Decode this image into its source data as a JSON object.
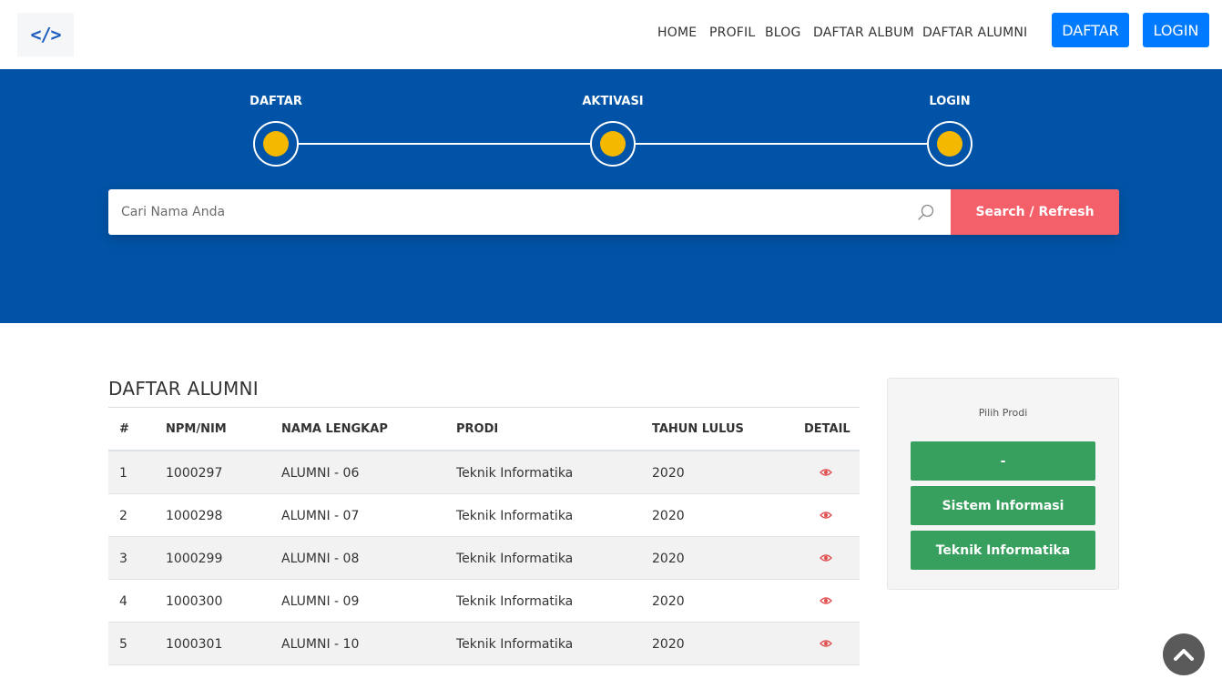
{
  "header": {
    "logo_text": "</>",
    "nav": [
      "HOME",
      "PROFIL",
      "BLOG",
      "DAFTAR ALBUM",
      "DAFTAR ALUMNI"
    ],
    "daftar_button": "DAFTAR",
    "login_button": "LOGIN"
  },
  "hero": {
    "steps": [
      "DAFTAR",
      "AKTIVASI",
      "LOGIN"
    ],
    "search": {
      "placeholder": "Cari Nama Anda",
      "value": "",
      "button": "Search / Refresh"
    }
  },
  "main": {
    "title": "DAFTAR ALUMNI",
    "columns": [
      "#",
      "NPM/NIM",
      "NAMA LENGKAP",
      "PRODI",
      "TAHUN LULUS",
      "DETAIL"
    ],
    "rows": [
      [
        "1",
        "1000297",
        "ALUMNI - 06",
        "Teknik Informatika",
        "2020"
      ],
      [
        "2",
        "1000298",
        "ALUMNI - 07",
        "Teknik Informatika",
        "2020"
      ],
      [
        "3",
        "1000299",
        "ALUMNI - 08",
        "Teknik Informatika",
        "2020"
      ],
      [
        "4",
        "1000300",
        "ALUMNI - 09",
        "Teknik Informatika",
        "2020"
      ],
      [
        "5",
        "1000301",
        "ALUMNI - 10",
        "Teknik Informatika",
        "2020"
      ]
    ],
    "detail_icon": "eye-icon"
  },
  "sidebar": {
    "title": "Pilih Prodi",
    "buttons": [
      "-",
      "Sistem Informasi",
      "Teknik Informatika"
    ]
  },
  "colors": {
    "brand_blue": "#0053a6",
    "nav_button": "#007bff",
    "step_dot": "#f5b800",
    "search_button": "#f4606a",
    "prodi_button": "#38a05f",
    "eye_icon": "#e05050"
  },
  "scroll_top_icon": "chevron-up-icon"
}
